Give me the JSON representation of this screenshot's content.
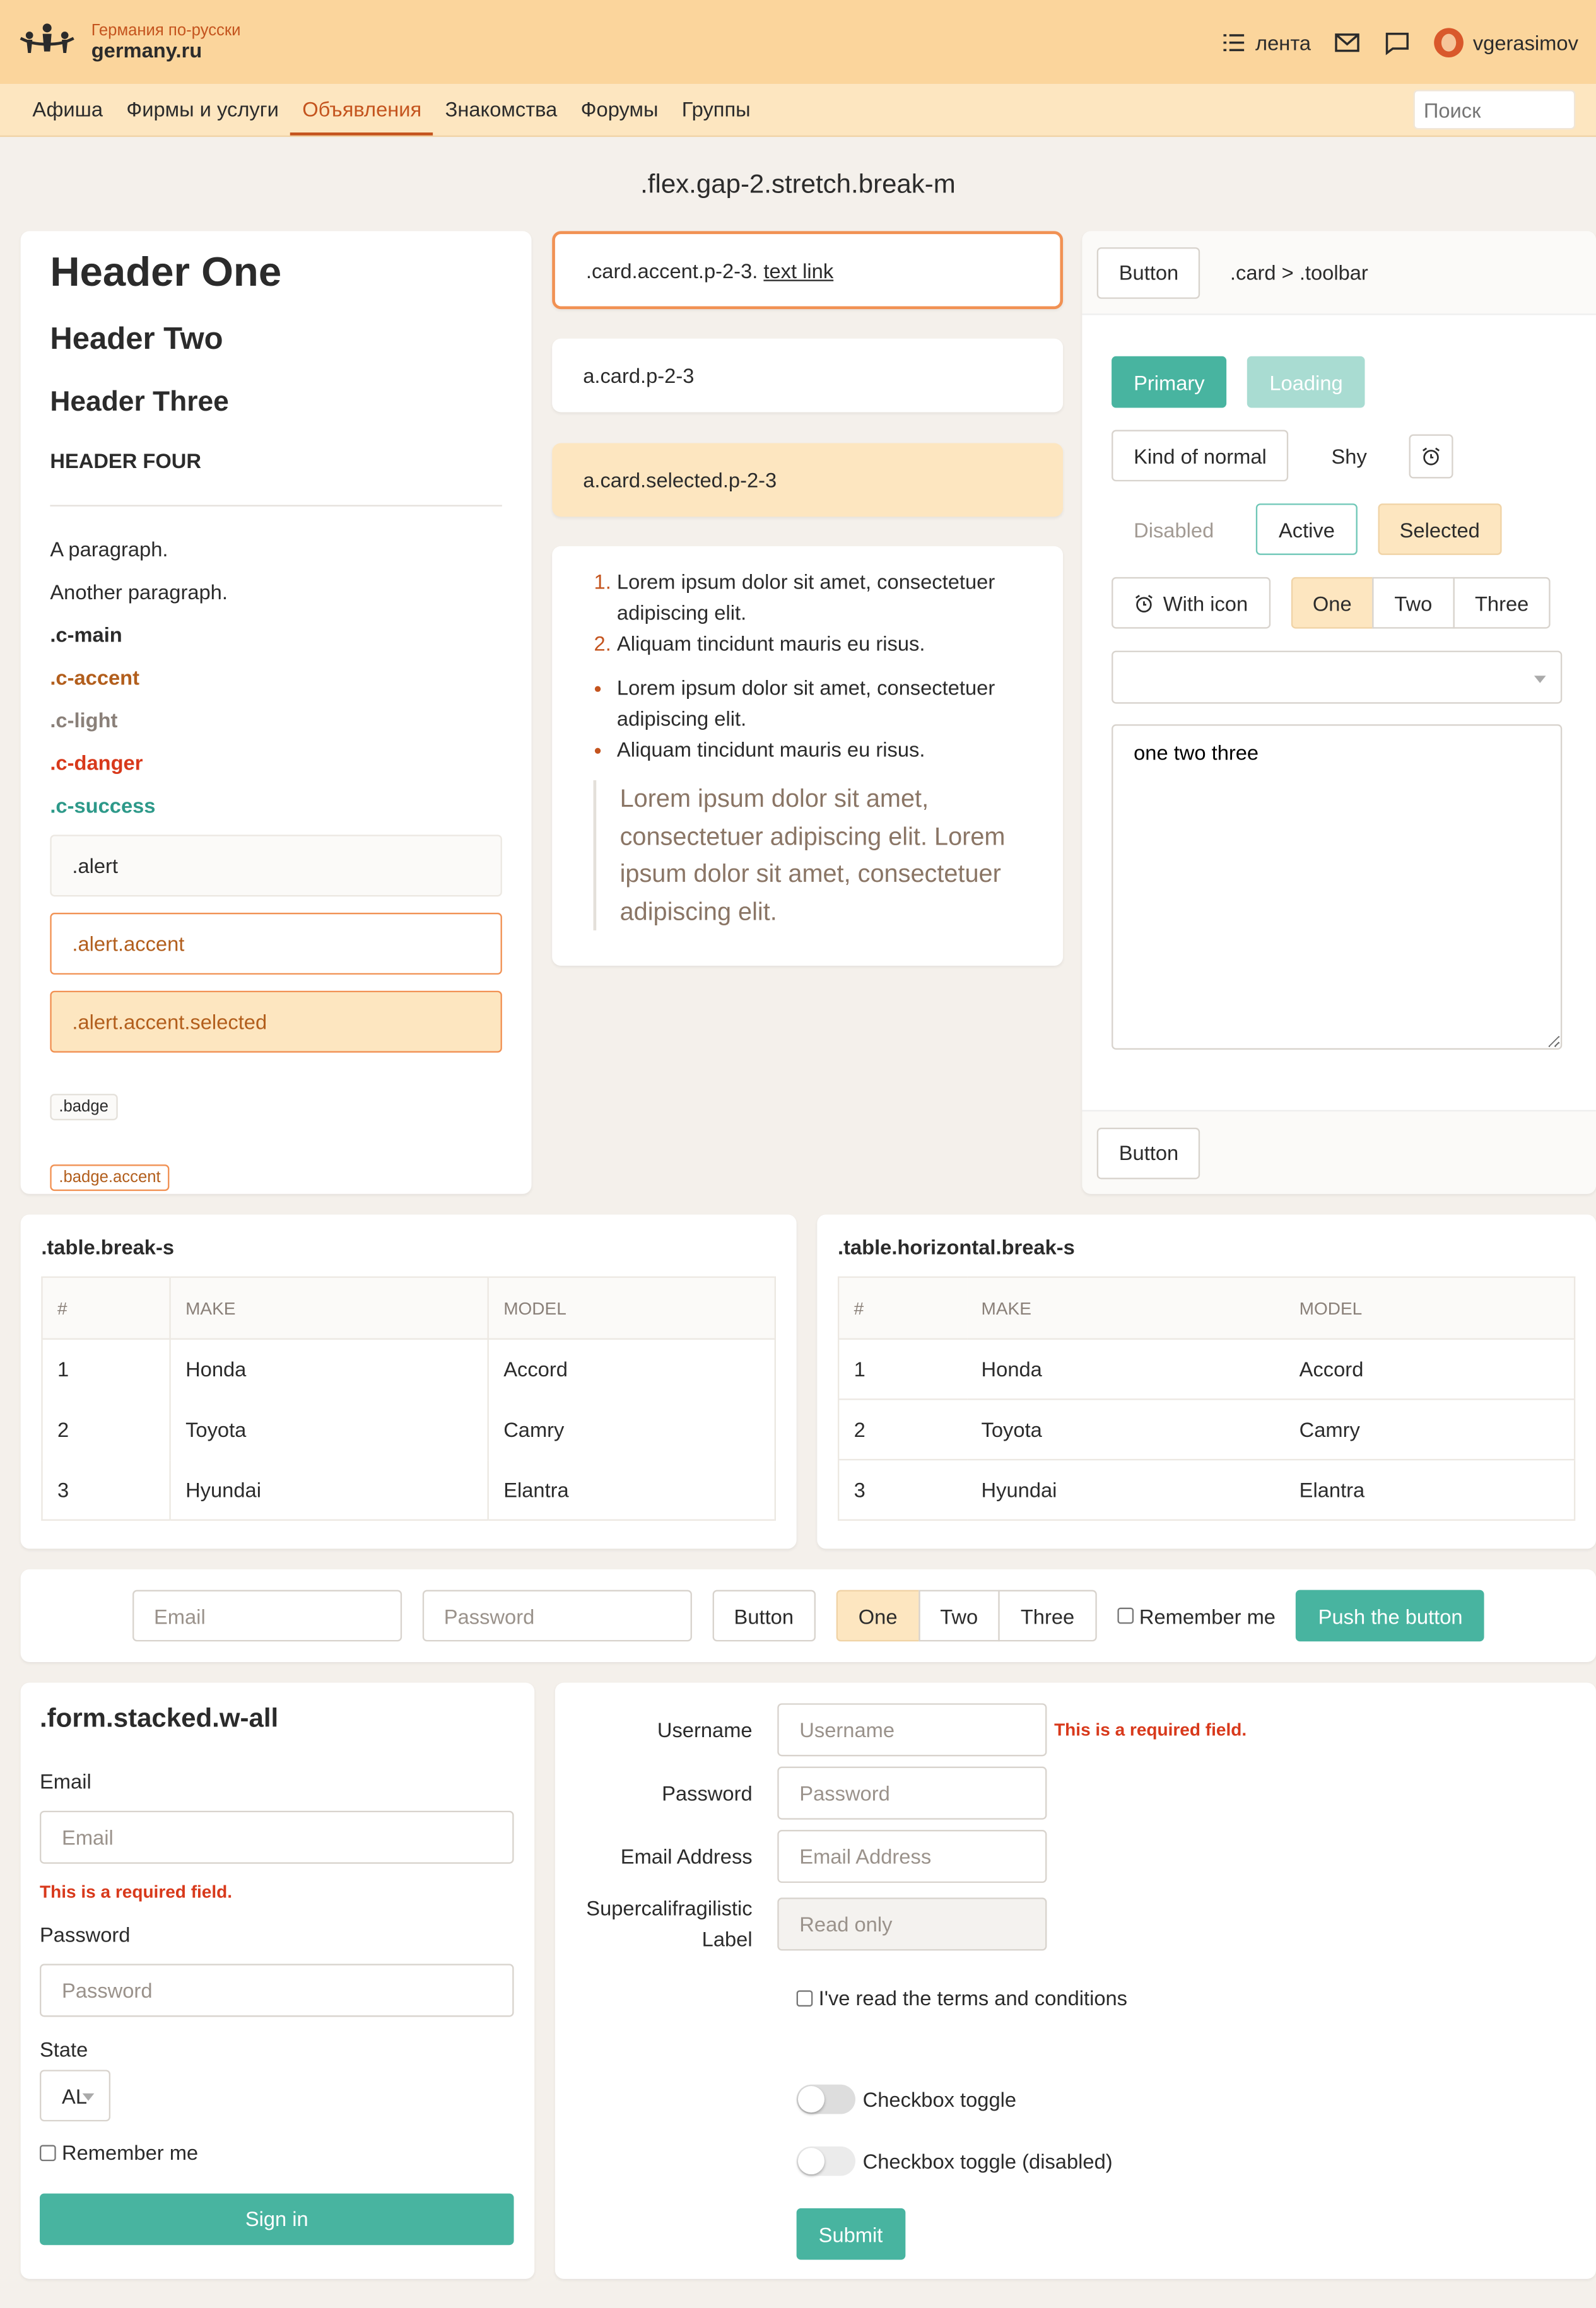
{
  "site": {
    "tagline": "Германия по-русски",
    "name": "germany.ru"
  },
  "top": {
    "feed": "лента",
    "username": "vgerasimov"
  },
  "nav": {
    "items": [
      "Афиша",
      "Фирмы и услуги",
      "Объявления",
      "Знакомства",
      "Форумы",
      "Группы"
    ],
    "search_placeholder": "Поиск"
  },
  "page_title": ".flex.gap-2.stretch.break-m",
  "col1": {
    "h1": "Header One",
    "h2": "Header Two",
    "h3": "Header Three",
    "h4": "HEADER FOUR",
    "p1": "A paragraph.",
    "p2": "Another paragraph.",
    "c_main": ".c-main",
    "c_accent": ".c-accent",
    "c_light": ".c-light",
    "c_danger": ".c-danger",
    "c_success": ".c-success",
    "alert": ".alert",
    "alert_accent": ".alert.accent",
    "alert_selected": ".alert.accent.selected",
    "badge": ".badge",
    "badge_accent": ".badge.accent"
  },
  "col2": {
    "card_accent_prefix": ".card.accent.p-2-3.",
    "card_accent_link": "text link",
    "card_link": "a.card.p-2-3",
    "card_selected": "a.card.selected.p-2-3",
    "ol": [
      "Lorem ipsum dolor sit amet, consectetuer adipiscing elit.",
      "Aliquam tincidunt mauris eu risus."
    ],
    "ul": [
      "Lorem ipsum dolor sit amet, consectetuer adipiscing elit.",
      "Aliquam tincidunt mauris eu risus."
    ],
    "quote": "Lorem ipsum dolor sit amet, consectetuer adipiscing elit. Lorem ipsum dolor sit amet, consectetuer adipiscing elit."
  },
  "col3": {
    "toolbar_button": "Button",
    "toolbar_text": ".card > .toolbar",
    "primary": "Primary",
    "loading": "Loading",
    "normal": "Kind of normal",
    "shy": "Shy",
    "disabled": "Disabled",
    "active": "Active",
    "selected": "Selected",
    "with_icon": "With icon",
    "group": [
      "One",
      "Two",
      "Three"
    ],
    "textarea": "one two three",
    "bottom_button": "Button"
  },
  "tables": {
    "left_title": ".table.break-s",
    "right_title": ".table.horizontal.break-s",
    "headers": [
      "#",
      "MAKE",
      "MODEL"
    ],
    "rows": [
      [
        "1",
        "Honda",
        "Accord"
      ],
      [
        "2",
        "Toyota",
        "Camry"
      ],
      [
        "3",
        "Hyundai",
        "Elantra"
      ]
    ]
  },
  "inline_form": {
    "email_placeholder": "Email",
    "password_placeholder": "Password",
    "button": "Button",
    "group": [
      "One",
      "Two",
      "Three"
    ],
    "remember": "Remember me",
    "push": "Push the button"
  },
  "stacked": {
    "title": ".form.stacked.w-all",
    "email_label": "Email",
    "email_placeholder": "Email",
    "error": "This is a required field.",
    "password_label": "Password",
    "password_placeholder": "Password",
    "state_label": "State",
    "state_value": "AL",
    "remember": "Remember me",
    "signin": "Sign in"
  },
  "hform": {
    "username_label": "Username",
    "username_placeholder": "Username",
    "error": "This is a required field.",
    "password_label": "Password",
    "password_placeholder": "Password",
    "email_label": "Email Address",
    "email_placeholder": "Email Address",
    "super_label": "Supercalifragilistic Label",
    "readonly_placeholder": "Read only",
    "terms": "I've read the terms and conditions",
    "toggle1": "Checkbox toggle",
    "toggle2": "Checkbox toggle (disabled)",
    "submit": "Submit"
  },
  "colors": {
    "accent": "#c4541e",
    "success": "#48b4a0",
    "topbar": "#fbd59c",
    "navbar": "#fde6c0"
  }
}
